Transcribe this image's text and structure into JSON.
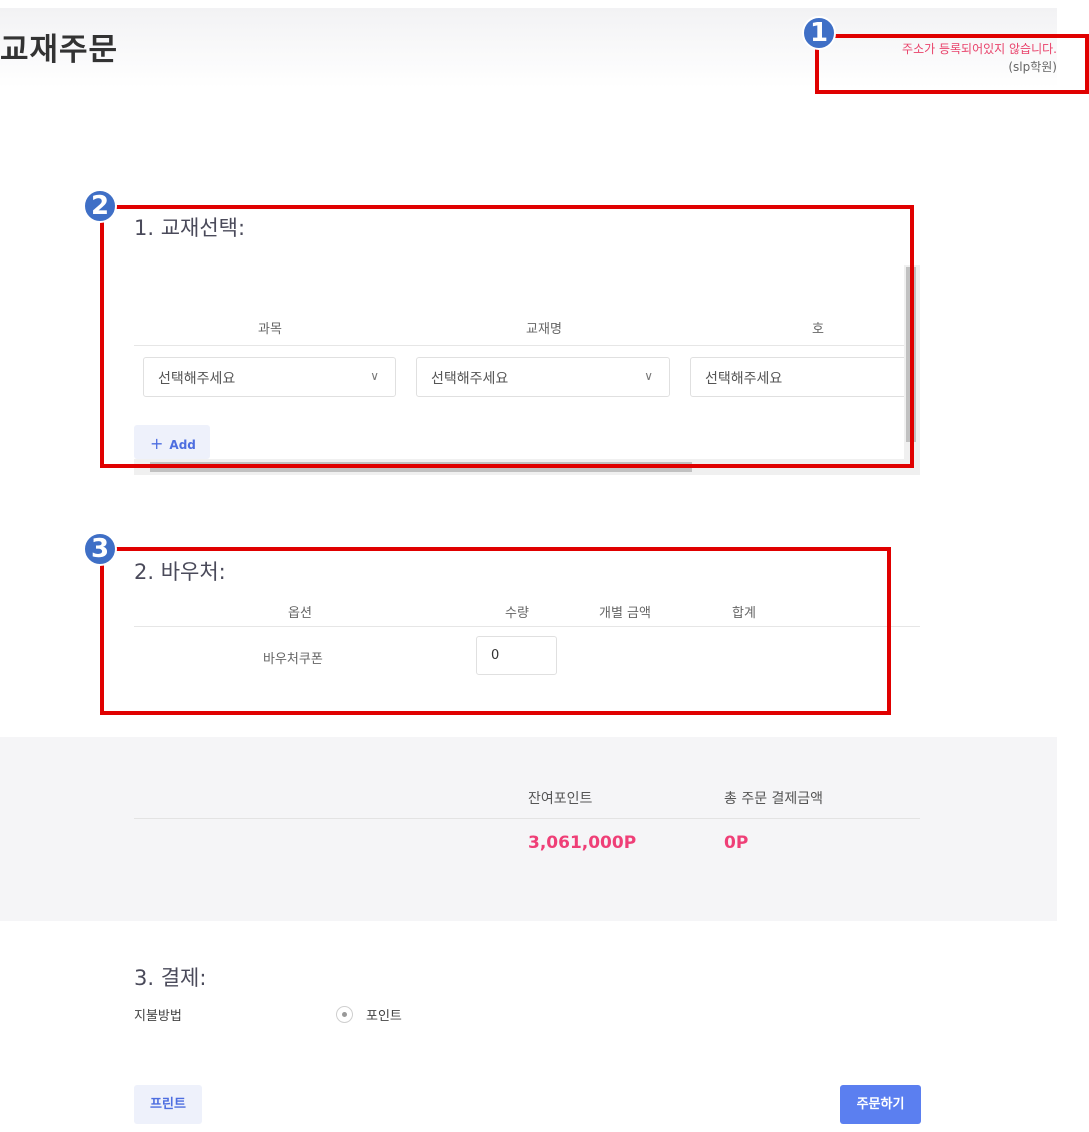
{
  "header": {
    "title": "교재주문",
    "address_warning": "주소가 등록되어있지 않습니다.",
    "academy": "(slp학원)"
  },
  "annotations": [
    "1",
    "2",
    "3"
  ],
  "section1": {
    "title": "1. 교재선택:",
    "columns": [
      "과목",
      "교재명",
      "호"
    ],
    "selects": [
      {
        "value": "선택해주세요"
      },
      {
        "value": "선택해주세요"
      },
      {
        "value": "선택해주세요"
      }
    ],
    "add_label": "Add"
  },
  "section2": {
    "title": "2. 바우처:",
    "columns": [
      "옵션",
      "수량",
      "개별 금액",
      "합계"
    ],
    "rows": [
      {
        "option": "바우처쿠폰",
        "quantity": "0"
      }
    ]
  },
  "summary": {
    "remaining_label": "잔여포인트",
    "total_label": "총 주문 결제금액",
    "remaining_value": "3,061,000P",
    "total_value": "0P"
  },
  "section3": {
    "title": "3. 결제:",
    "method_label": "지불방법",
    "method_option": "포인트"
  },
  "actions": {
    "print_label": "프린트",
    "order_label": "주문하기"
  },
  "colors": {
    "annotation_red": "#e00000",
    "badge_blue": "#3f6fc6",
    "point_pink": "#ef3f77",
    "primary_blue": "#5b7ff0"
  }
}
